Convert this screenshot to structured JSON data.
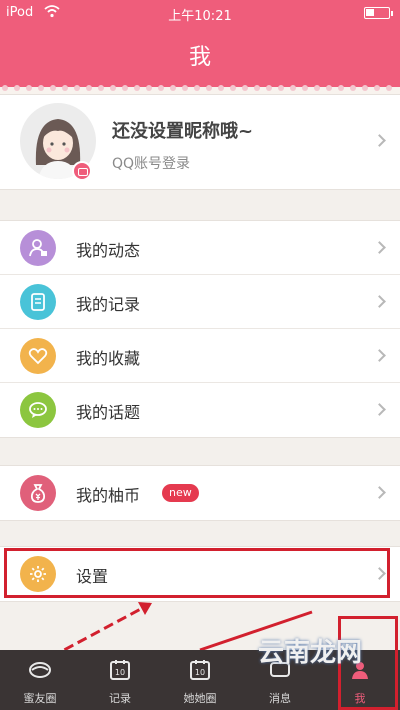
{
  "status_bar": {
    "carrier": "iPod",
    "time": "上午10:21"
  },
  "nav": {
    "title": "我"
  },
  "profile": {
    "nickname": "还没设置昵称哦~",
    "login_hint": "QQ账号登录"
  },
  "menu_group1": [
    {
      "label": "我的动态",
      "icon": "user-card-icon",
      "color": "#b78fd8"
    },
    {
      "label": "我的记录",
      "icon": "notebook-icon",
      "color": "#49c3d8"
    },
    {
      "label": "我的收藏",
      "icon": "heart-icon",
      "color": "#f2b34c"
    },
    {
      "label": "我的话题",
      "icon": "chat-bubble-icon",
      "color": "#8cc63f"
    }
  ],
  "menu_group2": [
    {
      "label": "我的柚币",
      "icon": "money-bag-icon",
      "color": "#e0607a",
      "badge": "new"
    }
  ],
  "menu_group3": [
    {
      "label": "设置",
      "icon": "gear-icon",
      "color": "#f2b34c"
    }
  ],
  "tabs": [
    {
      "label": "蜜友圈",
      "icon": "circle-bowl-icon",
      "active": false
    },
    {
      "label": "记录",
      "icon": "calendar-icon",
      "active": false
    },
    {
      "label": "她她圈",
      "icon": "calendar-icon",
      "active": false
    },
    {
      "label": "消息",
      "icon": "message-icon",
      "active": false
    },
    {
      "label": "我",
      "icon": "person-icon",
      "active": true
    }
  ],
  "watermark": "云南龙网",
  "colors": {
    "brand": "#ef5d7b",
    "tabbar": "#3a3434",
    "annotation": "#d2202e"
  }
}
